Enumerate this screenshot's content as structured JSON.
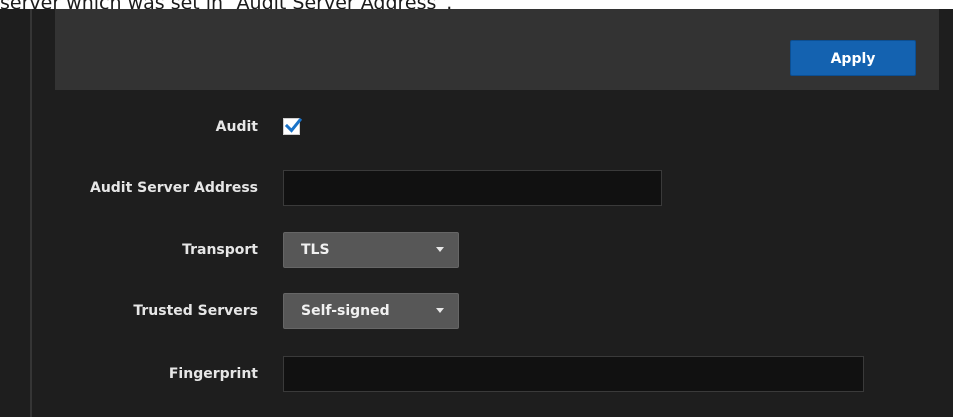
{
  "caption": "server which was set in “Audit Server Address”.",
  "toolbar": {
    "apply_label": "Apply"
  },
  "form": {
    "audit": {
      "label": "Audit",
      "checked": true
    },
    "audit_server_address": {
      "label": "Audit Server Address",
      "value": ""
    },
    "transport": {
      "label": "Transport",
      "selected": "TLS"
    },
    "trusted_servers": {
      "label": "Trusted Servers",
      "selected": "Self-signed"
    },
    "fingerprint": {
      "label": "Fingerprint",
      "value": ""
    }
  },
  "colors": {
    "background": "#1e1e1e",
    "toolbar": "#333333",
    "accent": "#1462b0",
    "checkmark": "#1a73c8"
  }
}
